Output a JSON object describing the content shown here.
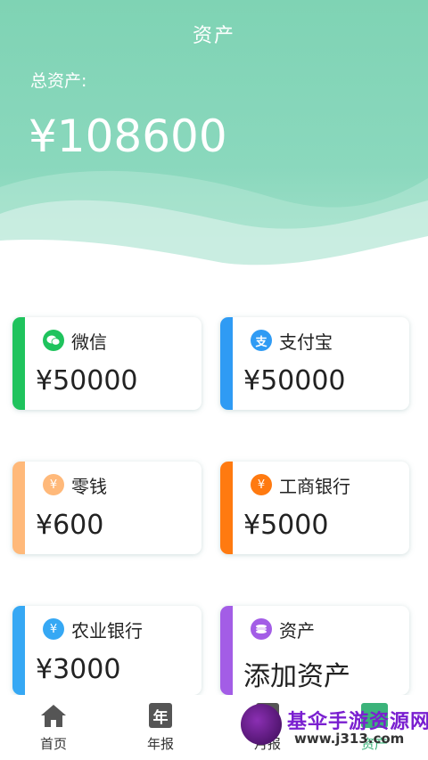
{
  "header": {
    "title": "资产",
    "total_label": "总资产:",
    "total_value": "¥108600"
  },
  "assets": [
    {
      "name": "微信",
      "amount": "¥50000",
      "color": "#1fc35d",
      "icon": "wechat-icon"
    },
    {
      "name": "支付宝",
      "amount": "¥50000",
      "color": "#2f9bf4",
      "icon": "alipay-icon"
    },
    {
      "name": "零钱",
      "amount": "¥600",
      "color": "#ffb97a",
      "icon": "yuan-coin-icon"
    },
    {
      "name": "工商银行",
      "amount": "¥5000",
      "color": "#ff7a10",
      "icon": "yuan-coin-icon"
    },
    {
      "name": "农业银行",
      "amount": "¥3000",
      "color": "#36a8f4",
      "icon": "yuan-coin-icon"
    },
    {
      "name": "资产",
      "amount": "添加资产",
      "color": "#a35de6",
      "icon": "add-asset-icon"
    }
  ],
  "tabbar": {
    "items": [
      {
        "label": "首页",
        "icon": "home-icon"
      },
      {
        "label": "年报",
        "icon": "year-report-icon",
        "icon_char": "年"
      },
      {
        "label": "月报",
        "icon": "month-report-icon"
      },
      {
        "label": "资产",
        "icon": "assets-icon"
      }
    ]
  },
  "watermark": {
    "line1": "基伞手游资源网",
    "line2": "www.j313.com"
  }
}
